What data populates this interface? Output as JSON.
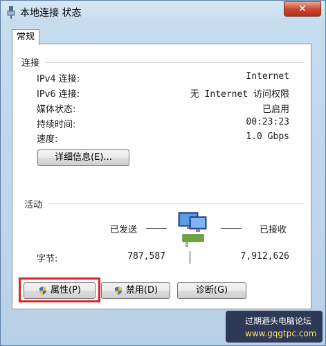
{
  "window": {
    "title": "本地连接 状态",
    "close_label": "✕"
  },
  "tabs": [
    {
      "label": "常规"
    }
  ],
  "connection": {
    "section_label": "连接",
    "rows": [
      {
        "label": "IPv4 连接:",
        "value": "Internet"
      },
      {
        "label": "IPv6 连接:",
        "value": "无 Internet 访问权限"
      },
      {
        "label": "媒体状态:",
        "value": "已启用"
      },
      {
        "label": "持续时间:",
        "value": "00:23:23"
      },
      {
        "label": "速度:",
        "value": "1.0 Gbps"
      }
    ],
    "details_button": "详细信息(E)..."
  },
  "activity": {
    "section_label": "活动",
    "sent_label": "已发送",
    "received_label": "已接收",
    "bytes_label": "字节:",
    "bytes_sent": "787,587",
    "bytes_received": "7,912,626"
  },
  "buttons": {
    "properties": "属性(P)",
    "disable": "禁用(D)",
    "diagnose": "诊断(G)"
  },
  "watermark": {
    "line1": "过期避头电脑论坛",
    "line2": "www.gqgtpc.com"
  },
  "icons": {
    "network": "network-computers-icon",
    "shield": "uac-shield-icon",
    "adapter": "network-adapter-icon"
  }
}
